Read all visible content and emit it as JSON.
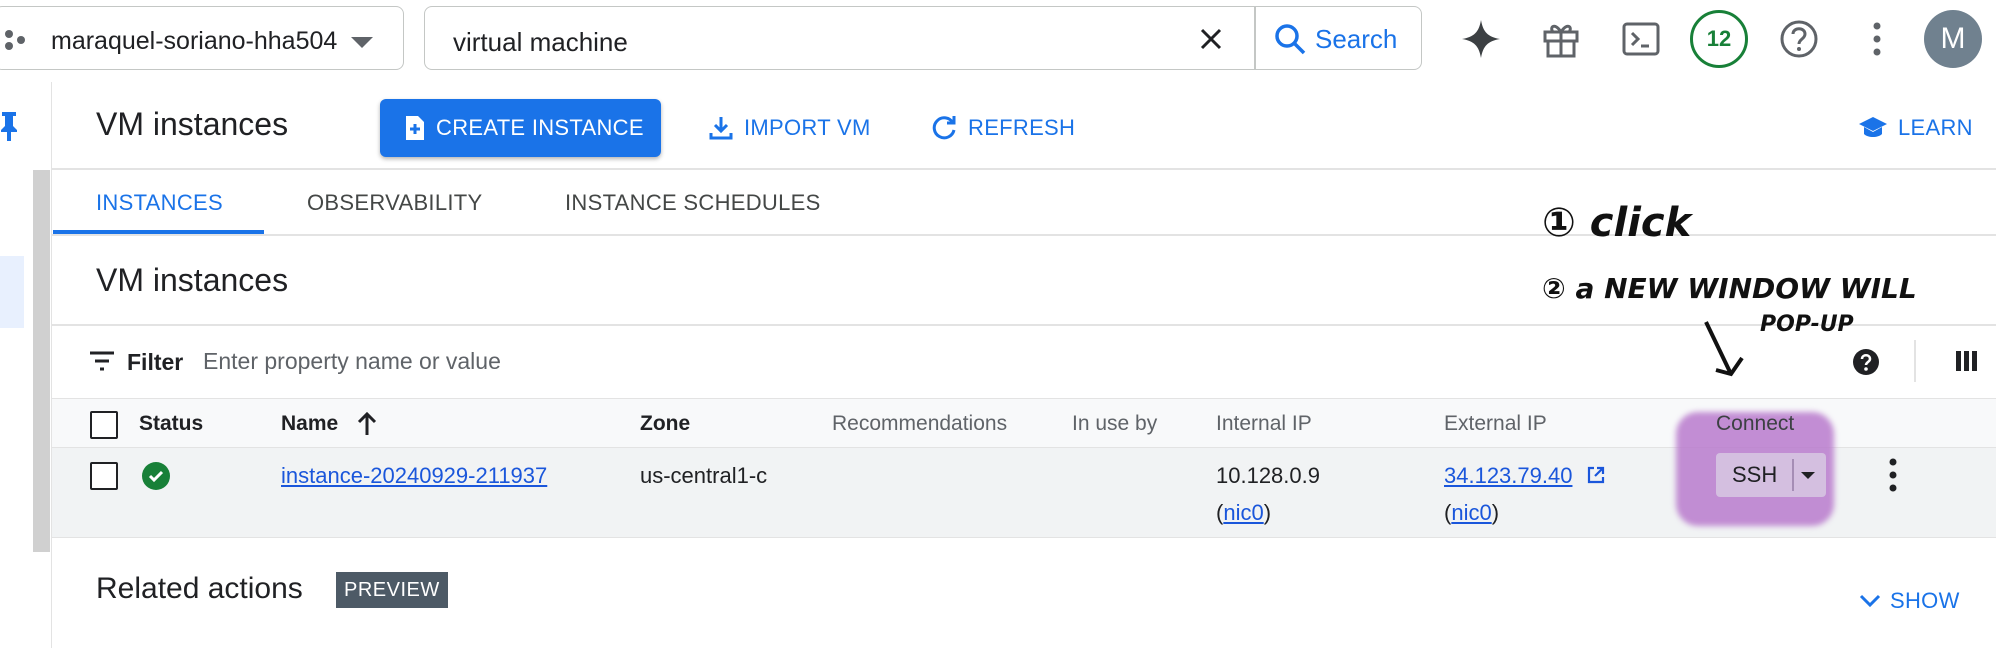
{
  "topbar": {
    "project": "maraquel-soriano-hha504",
    "search_value": "virtual machine",
    "search_button": "Search",
    "notification_count": "12",
    "avatar_letter": "M"
  },
  "toolbar": {
    "title": "VM instances",
    "create_instance": "CREATE INSTANCE",
    "import_vm": "IMPORT VM",
    "refresh": "REFRESH",
    "learn": "LEARN"
  },
  "tabs": [
    {
      "label": "INSTANCES",
      "active": true
    },
    {
      "label": "OBSERVABILITY",
      "active": false
    },
    {
      "label": "INSTANCE SCHEDULES",
      "active": false
    }
  ],
  "section_title": "VM instances",
  "filter": {
    "label": "Filter",
    "placeholder": "Enter property name or value"
  },
  "table": {
    "columns": {
      "status": "Status",
      "name": "Name",
      "zone": "Zone",
      "recommendations": "Recommendations",
      "in_use_by": "In use by",
      "internal_ip": "Internal IP",
      "external_ip": "External IP",
      "connect": "Connect"
    },
    "rows": [
      {
        "status": "running",
        "name": "instance-20240929-211937",
        "zone": "us-central1-c",
        "recommendations": "",
        "in_use_by": "",
        "internal_ip": "10.128.0.9",
        "internal_nic_open": "(",
        "internal_nic": "nic0",
        "internal_nic_close": ")",
        "external_ip": "34.123.79.40",
        "external_nic_open": "(",
        "external_nic": "nic0",
        "external_nic_close": ")",
        "connect": "SSH"
      }
    ]
  },
  "related": {
    "title": "Related actions",
    "badge": "PREVIEW",
    "show": "SHOW"
  },
  "annotation": {
    "step1": "① click",
    "step2": "② a NEW WINDOW WILL",
    "step2_cont": "POP-UP"
  },
  "colors": {
    "primary": "#1a73e8",
    "success": "#188038",
    "highlight": "#b87acc"
  },
  "icons": {
    "project": "project-nodes-icon",
    "clear": "close-icon",
    "search": "search-icon",
    "gemini": "sparkle-icon",
    "gift": "gift-icon",
    "cloud_shell": "terminal-icon",
    "help": "help-circle-icon",
    "more": "more-vert-icon",
    "pin": "pin-icon",
    "create": "add-box-icon",
    "import": "download-icon",
    "refresh": "refresh-icon",
    "learn": "school-icon",
    "filter": "filter-icon",
    "columns": "columns-icon",
    "status_ok": "check-circle-icon",
    "external_link": "open-in-new-icon",
    "show": "chevron-down-icon"
  }
}
